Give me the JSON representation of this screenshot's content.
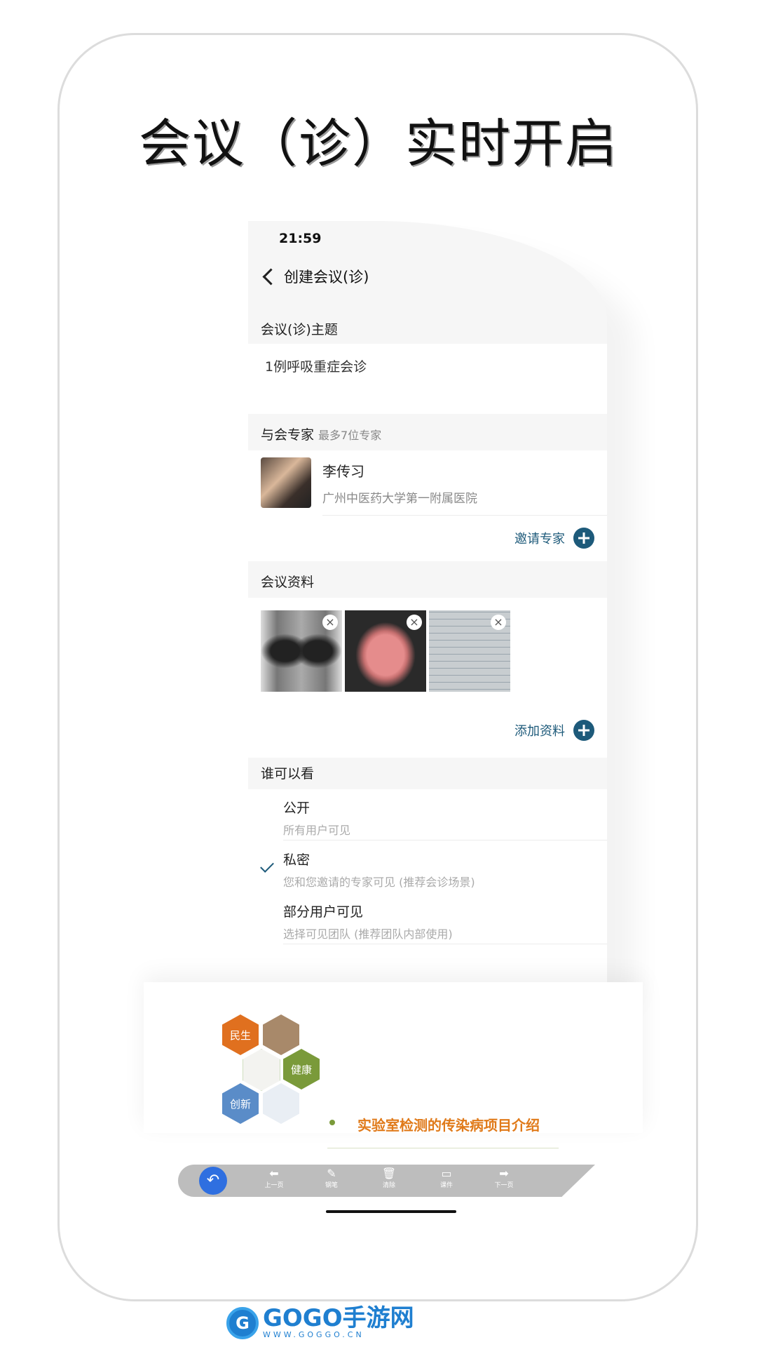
{
  "headline": "会议（诊）实时开启",
  "status_time": "21:59",
  "nav": {
    "title": "创建会议(诊)"
  },
  "topic": {
    "label": "会议(诊)主题",
    "value": "1例呼吸重症会诊"
  },
  "experts": {
    "label": "与会专家",
    "hint": "最多7位专家",
    "items": [
      {
        "name": "李传习",
        "org": "广州中医药大学第一附属医院"
      }
    ],
    "invite_label": "邀请专家"
  },
  "materials": {
    "label": "会议资料",
    "add_label": "添加资料",
    "close_glyph": "×"
  },
  "visibility": {
    "label": "谁可以看",
    "options": [
      {
        "title": "公开",
        "desc": "所有用户可见",
        "selected": false
      },
      {
        "title": "私密",
        "desc": "您和您邀请的专家可见 (推荐会诊场景)",
        "selected": true
      },
      {
        "title": "部分用户可见",
        "desc": "选择可见团队 (推荐团队内部使用)",
        "selected": false
      }
    ]
  },
  "slide": {
    "hex_labels": [
      "民生",
      "健康",
      "创新"
    ],
    "title": "实验室检测的传染病项目介绍"
  },
  "toolbar": {
    "undo_icon": "undo-icon",
    "tools": [
      {
        "icon": "left-arrow-icon",
        "label": "上一页"
      },
      {
        "icon": "pen-icon",
        "label": "钢笔"
      },
      {
        "icon": "trash-icon",
        "label": "清除"
      },
      {
        "icon": "folder-icon",
        "label": "课件"
      },
      {
        "icon": "right-arrow-icon",
        "label": "下一页"
      }
    ]
  },
  "brand": {
    "name": "GOGO手游网",
    "url": "WWW.GOGGO.CN"
  }
}
